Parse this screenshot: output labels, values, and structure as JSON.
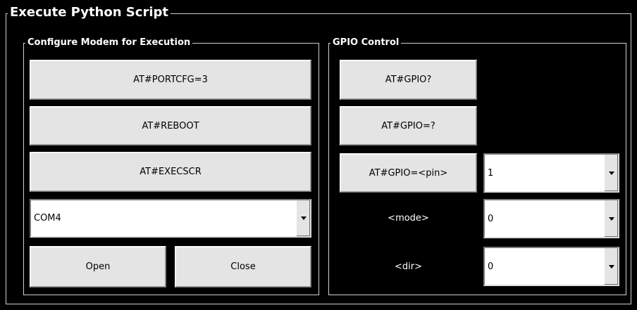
{
  "window": {
    "title": "Execute Python Script"
  },
  "modem": {
    "title": "Configure Modem for Execution",
    "portcfg_label": "AT#PORTCFG=3",
    "reboot_label": "AT#REBOOT",
    "execscr_label": "AT#EXECSCR",
    "port_value": "COM4",
    "open_label": "Open",
    "close_label": "Close"
  },
  "gpio": {
    "title": "GPIO Control",
    "query_label": "AT#GPIO?",
    "test_label": "AT#GPIO=?",
    "set_label": "AT#GPIO=<pin>",
    "pin_value": "1",
    "mode_label": "<mode>",
    "mode_value": "0",
    "dir_label": "<dir>",
    "dir_value": "0"
  }
}
